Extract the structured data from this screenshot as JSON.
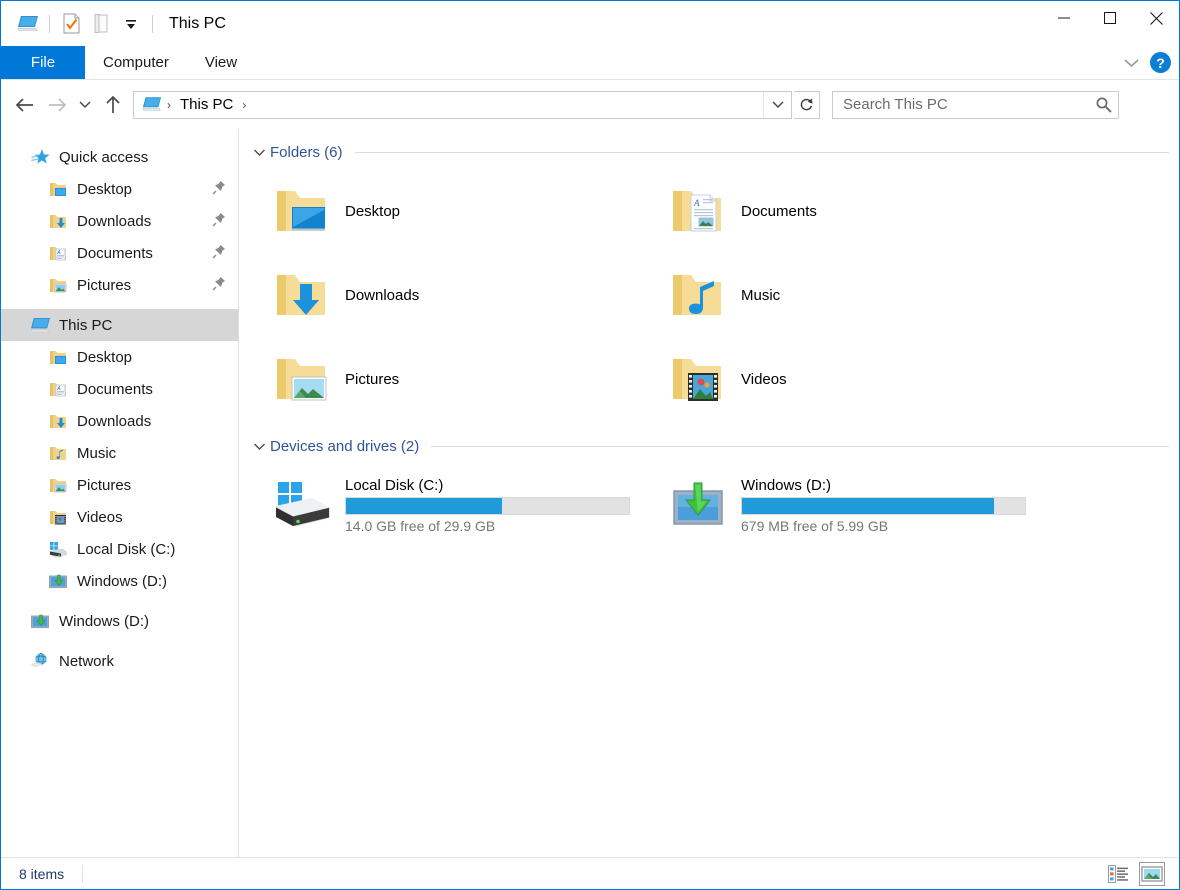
{
  "window": {
    "title": "This PC",
    "quick_access_toolbar": [
      {
        "name": "this-pc-icon",
        "label": "This PC"
      },
      {
        "name": "properties-icon",
        "label": "Properties"
      },
      {
        "name": "new-folder-icon",
        "label": "New folder"
      },
      {
        "name": "customize-dropdown-icon",
        "label": "Customize Quick Access Toolbar"
      }
    ],
    "controls": {
      "minimize": "—",
      "maximize": "□",
      "close": "✕"
    }
  },
  "ribbon": {
    "tabs": [
      {
        "label": "File",
        "active": true
      },
      {
        "label": "Computer",
        "active": false
      },
      {
        "label": "View",
        "active": false
      }
    ],
    "collapse_label": "⌄",
    "help_label": "?"
  },
  "address": {
    "back_label": "Back",
    "forward_label": "Forward",
    "history_label": "Recent locations",
    "up_label": "Up",
    "breadcrumb_icon": "this-pc-icon",
    "breadcrumb": [
      "This PC"
    ],
    "separator": "›",
    "dropdown_label": "⌄",
    "refresh_label": "↻"
  },
  "search": {
    "placeholder": "Search This PC",
    "value": "",
    "icon": "search-icon"
  },
  "sidebar": {
    "items": [
      {
        "label": "Quick access",
        "icon": "quick-access-star-icon",
        "level": 0,
        "pinned": false,
        "selected": false
      },
      {
        "label": "Desktop",
        "icon": "folder-desktop-icon",
        "level": 1,
        "pinned": true,
        "selected": false
      },
      {
        "label": "Downloads",
        "icon": "folder-downloads-icon",
        "level": 1,
        "pinned": true,
        "selected": false
      },
      {
        "label": "Documents",
        "icon": "folder-documents-icon",
        "level": 1,
        "pinned": true,
        "selected": false
      },
      {
        "label": "Pictures",
        "icon": "folder-pictures-icon",
        "level": 1,
        "pinned": true,
        "selected": false
      },
      {
        "label": "This PC",
        "icon": "this-pc-icon",
        "level": 0,
        "pinned": false,
        "selected": true
      },
      {
        "label": "Desktop",
        "icon": "folder-desktop-icon",
        "level": 1,
        "pinned": false,
        "selected": false
      },
      {
        "label": "Documents",
        "icon": "folder-documents-icon",
        "level": 1,
        "pinned": false,
        "selected": false
      },
      {
        "label": "Downloads",
        "icon": "folder-downloads-icon",
        "level": 1,
        "pinned": false,
        "selected": false
      },
      {
        "label": "Music",
        "icon": "folder-music-icon",
        "level": 1,
        "pinned": false,
        "selected": false
      },
      {
        "label": "Pictures",
        "icon": "folder-pictures-icon",
        "level": 1,
        "pinned": false,
        "selected": false
      },
      {
        "label": "Videos",
        "icon": "folder-videos-icon",
        "level": 1,
        "pinned": false,
        "selected": false
      },
      {
        "label": "Local Disk (C:)",
        "icon": "local-disk-icon",
        "level": 1,
        "pinned": false,
        "selected": false
      },
      {
        "label": "Windows (D:)",
        "icon": "network-drive-icon",
        "level": 1,
        "pinned": false,
        "selected": false
      },
      {
        "label": "Windows (D:)",
        "icon": "network-drive-icon",
        "level": 0,
        "pinned": false,
        "selected": false
      },
      {
        "label": "Network",
        "icon": "network-icon",
        "level": 0,
        "pinned": false,
        "selected": false
      }
    ]
  },
  "main": {
    "groups": [
      {
        "title": "Folders (6)",
        "collapse_icon": "chevron-down-icon",
        "items": [
          {
            "label": "Desktop",
            "icon": "folder-desktop-icon"
          },
          {
            "label": "Documents",
            "icon": "folder-documents-icon"
          },
          {
            "label": "Downloads",
            "icon": "folder-downloads-icon"
          },
          {
            "label": "Music",
            "icon": "folder-music-icon"
          },
          {
            "label": "Pictures",
            "icon": "folder-pictures-icon"
          },
          {
            "label": "Videos",
            "icon": "folder-videos-icon"
          }
        ]
      },
      {
        "title": "Devices and drives (2)",
        "collapse_icon": "chevron-down-icon",
        "drives": [
          {
            "label": "Local Disk (C:)",
            "icon": "local-disk-icon",
            "free_text": "14.0 GB free of 29.9 GB",
            "used_percent": 55,
            "bar_color": "#1f9bda"
          },
          {
            "label": "Windows (D:)",
            "icon": "network-drive-icon",
            "free_text": "679 MB free of 5.99 GB",
            "used_percent": 89,
            "bar_color": "#1f9bda"
          }
        ]
      }
    ]
  },
  "statusbar": {
    "item_count": "8 items",
    "view_buttons": [
      {
        "name": "details-view-button",
        "label": "Details view",
        "active": false
      },
      {
        "name": "large-icons-view-button",
        "label": "Large icons view",
        "active": true
      }
    ]
  },
  "colors": {
    "accent": "#0078d7",
    "group_title": "#2f5496",
    "selection": "#d6d6d6",
    "progress": "#1f9bda",
    "status_text": "#1f3864"
  }
}
